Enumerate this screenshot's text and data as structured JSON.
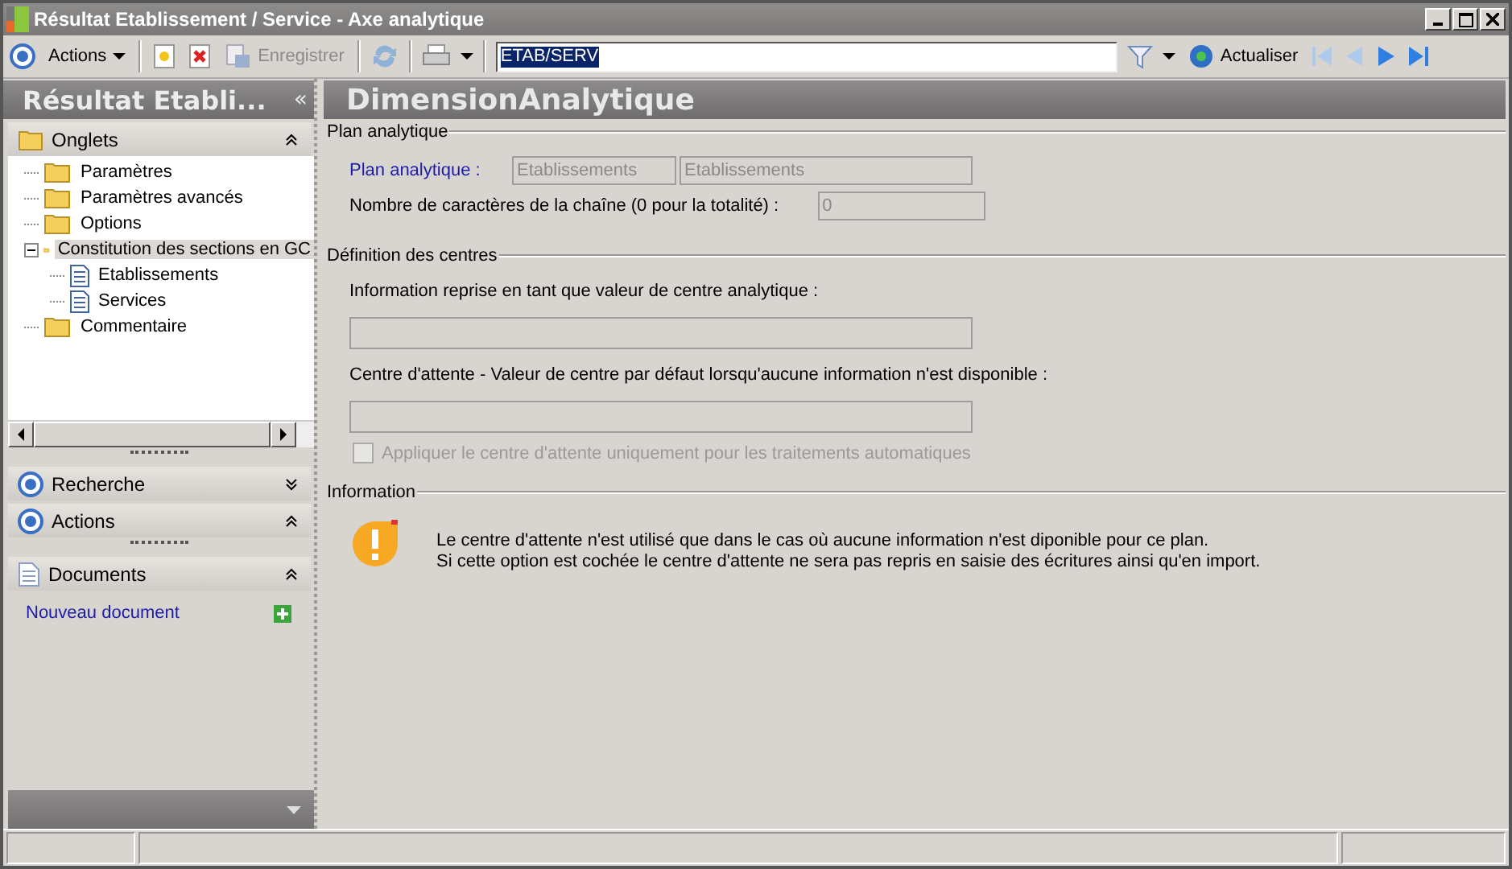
{
  "window": {
    "title": "Résultat Etablissement / Service -  Axe analytique"
  },
  "toolbar": {
    "actions_label": "Actions",
    "save_label": "Enregistrer",
    "save_disabled": true,
    "search_value": "ETAB/SERV",
    "refresh_label": "Actualiser"
  },
  "sidebar": {
    "title": "Résultat Etabli...",
    "collapse_glyph": "«",
    "tree_panel": {
      "title": "Onglets",
      "expanded": true,
      "items": [
        {
          "label": "Paramètres",
          "kind": "folder",
          "selected": false
        },
        {
          "label": "Paramètres avancés",
          "kind": "folder",
          "selected": false
        },
        {
          "label": "Options",
          "kind": "folder",
          "selected": false
        },
        {
          "label": "Constitution des sections en GC",
          "kind": "folder",
          "selected": true,
          "expanded": true,
          "children": [
            {
              "label": "Etablissements",
              "kind": "doc",
              "selected": false
            },
            {
              "label": "Services",
              "kind": "doc",
              "selected": false
            }
          ]
        },
        {
          "label": "Commentaire",
          "kind": "folder",
          "selected": false
        }
      ]
    },
    "panels": [
      {
        "title": "Recherche",
        "expanded": false
      },
      {
        "title": "Actions",
        "expanded": true
      }
    ],
    "documents": {
      "title": "Documents",
      "expanded": true,
      "link": "Nouveau document"
    }
  },
  "content": {
    "title": "DimensionAnalytique",
    "plan_section": {
      "title": "Plan analytique",
      "plan_label": "Plan analytique :",
      "plan_code": "Etablissements",
      "plan_name": "Etablissements",
      "length_label": "Nombre de caractères de la chaîne (0 pour la totalité) :",
      "length_value": "0"
    },
    "centres_section": {
      "title": "Définition des centres",
      "info_label": "Information reprise en tant que valeur de centre analytique :",
      "waiting_label": "Centre d'attente - Valeur de centre par défaut lorsqu'aucune information n'est disponible :",
      "apply_checkbox": {
        "label": "Appliquer le centre d'attente uniquement pour les traitements automatiques",
        "checked": false,
        "disabled": true
      }
    },
    "info_section": {
      "title": "Information",
      "lines": [
        "Le centre d'attente n'est utilisé que dans le cas où aucune information n'est diponible pour ce plan.",
        "Si cette option est cochée le centre d'attente ne sera pas repris en saisie des écritures ainsi qu'en import."
      ]
    }
  }
}
